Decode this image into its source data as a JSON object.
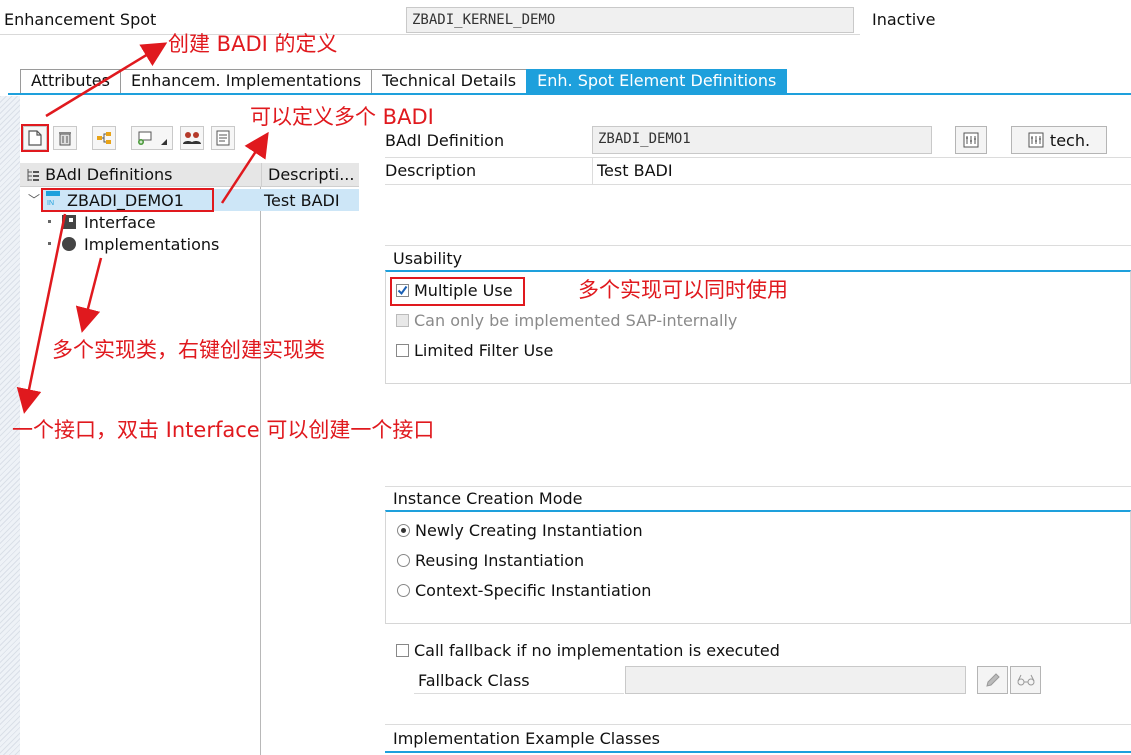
{
  "header": {
    "label": "Enhancement Spot",
    "spot_name": "ZBADI_KERNEL_DEMO",
    "status": "Inactive"
  },
  "tabs": [
    {
      "label": "Attributes",
      "active": false
    },
    {
      "label": "Enhancem. Implementations",
      "active": false
    },
    {
      "label": "Technical Details",
      "active": false
    },
    {
      "label": "Enh. Spot Element Definitions",
      "active": true
    }
  ],
  "toolbar": {
    "icons": [
      "create-icon",
      "delete-icon",
      "hierarchy-icon",
      "add-implementation-icon",
      "users-icon",
      "documentation-icon"
    ]
  },
  "tree": {
    "col1": "BAdI Definitions",
    "col2": "Descripti...",
    "items": [
      {
        "name": "ZBADI_DEMO1",
        "description": "Test BADI",
        "selected": true
      },
      {
        "name": "Interface"
      },
      {
        "name": "Implementations"
      }
    ]
  },
  "detail": {
    "badi_label": "BAdI Definition",
    "badi_value": "ZBADI_DEMO1",
    "tech_button": "tech.",
    "desc_label": "Description",
    "desc_value": "Test BADI"
  },
  "usability": {
    "title": "Usability",
    "multiple_use": "Multiple Use",
    "multiple_use_checked": true,
    "sap_internal": "Can only be implemented SAP-internally",
    "limited_filter": "Limited Filter Use"
  },
  "instance_mode": {
    "title": "Instance Creation Mode",
    "options": [
      "Newly Creating Instantiation",
      "Reusing Instantiation",
      "Context-Specific Instantiation"
    ],
    "selected": "Newly Creating Instantiation"
  },
  "fallback": {
    "call_label": "Call fallback if no implementation is executed",
    "class_label": "Fallback Class",
    "class_value": ""
  },
  "examples": {
    "title": "Implementation Example Classes"
  },
  "annotations": {
    "create_badi": "创建 BADI 的定义",
    "multi_badi": "可以定义多个 BADI",
    "multi_use": "多个实现可以同时使用",
    "impl_classes": "多个实现类，右键创建实现类",
    "interface": "一个接口，双击 Interface 可以创建一个接口"
  },
  "colors": {
    "accent": "#1ea0dc",
    "annotation": "#e0191e"
  }
}
